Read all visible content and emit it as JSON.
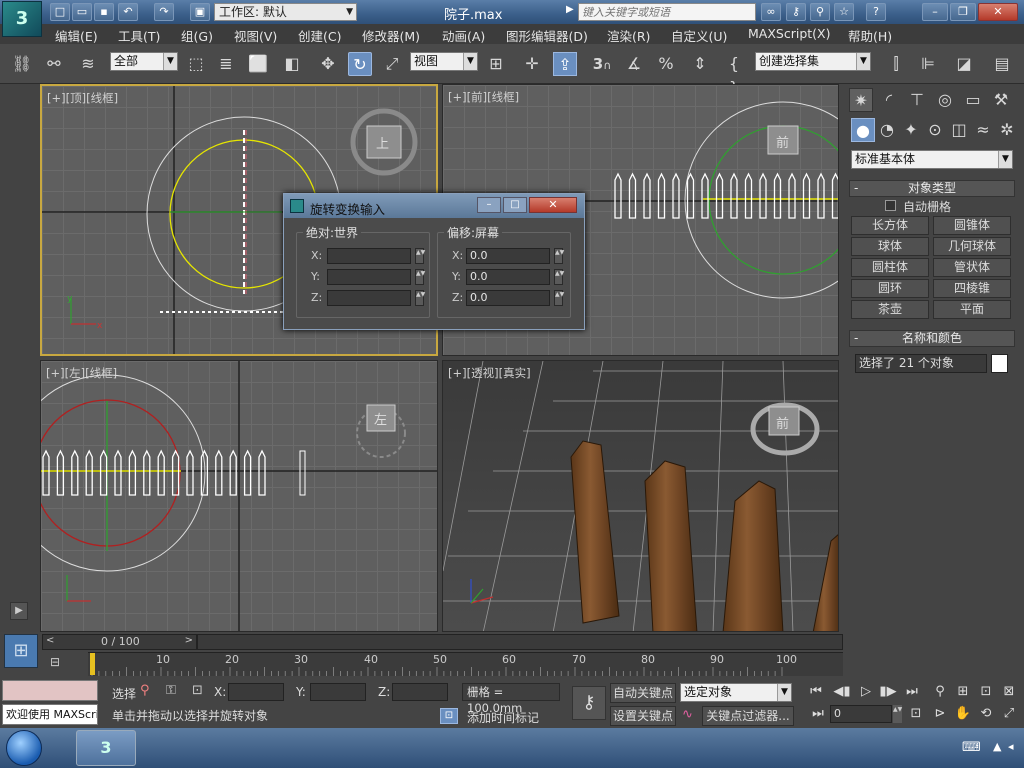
{
  "titlebar": {
    "workspace_label": "工作区: 默认",
    "file_name": "院子.max",
    "search_placeholder": "键入关键字或短语",
    "help_label": "?"
  },
  "menu": [
    "编辑(E)",
    "工具(T)",
    "组(G)",
    "视图(V)",
    "创建(C)",
    "修改器(M)",
    "动画(A)",
    "图形编辑器(D)",
    "渲染(R)",
    "自定义(U)",
    "MAXScript(X)",
    "帮助(H)"
  ],
  "toolbar": {
    "selection_filter": "全部",
    "ref_coord": "视图",
    "snap_number": "3",
    "named_selection": "创建选择集"
  },
  "viewports": {
    "top": {
      "label_plus": "[+]",
      "label_view": "[顶]",
      "label_mode": "[线框]",
      "cube_label": "上"
    },
    "front": {
      "label_plus": "[+]",
      "label_view": "[前]",
      "label_mode": "[线框]",
      "cube_label": "前"
    },
    "left": {
      "label_plus": "[+]",
      "label_view": "[左]",
      "label_mode": "[线框]",
      "cube_label": "左"
    },
    "persp": {
      "label_plus": "[+]",
      "label_view": "[透视]",
      "label_mode": "[真实]",
      "cube_label": "前"
    }
  },
  "dialog": {
    "title": "旋转变换输入",
    "abs_group": "绝对:世界",
    "offset_group": "偏移:屏幕",
    "x_label": "X:",
    "y_label": "Y:",
    "z_label": "Z:",
    "abs_values": {
      "x": "",
      "y": "",
      "z": ""
    },
    "offset_values": {
      "x": "0.0",
      "y": "0.0",
      "z": "0.0"
    }
  },
  "command_panel": {
    "category": "标准基本体",
    "object_type_title": "对象类型",
    "autogrid_label": "自动栅格",
    "buttons": [
      "长方体",
      "圆锥体",
      "球体",
      "几何球体",
      "圆柱体",
      "管状体",
      "圆环",
      "四棱锥",
      "茶壶",
      "平面"
    ],
    "name_color_title": "名称和颜色",
    "name_field": "选择了 21 个对象"
  },
  "timeline": {
    "slider_label": "0 / 100",
    "ticks": [
      "10",
      "20",
      "30",
      "40",
      "50",
      "60",
      "70",
      "80",
      "90",
      "100"
    ]
  },
  "status": {
    "welcome": "欢迎使用 MAXScri",
    "select_label": "选择",
    "x_label": "X:",
    "y_label": "Y:",
    "z_label": "Z:",
    "grid_label": "栅格 = 100.0mm",
    "prompt": "单击并拖动以选择并旋转对象",
    "add_time_tag": "添加时间标记",
    "auto_key": "自动关键点",
    "set_key": "设置关键点",
    "key_mode": "选定对象",
    "key_filter": "关键点过滤器...",
    "frame_value": "0"
  },
  "colors": {
    "accent_yellow": "#e6e600",
    "viewport_bg": "#5f5f5f",
    "active_border": "#c8a840",
    "circle_red": "#b02020",
    "circle_green": "#30a030"
  }
}
